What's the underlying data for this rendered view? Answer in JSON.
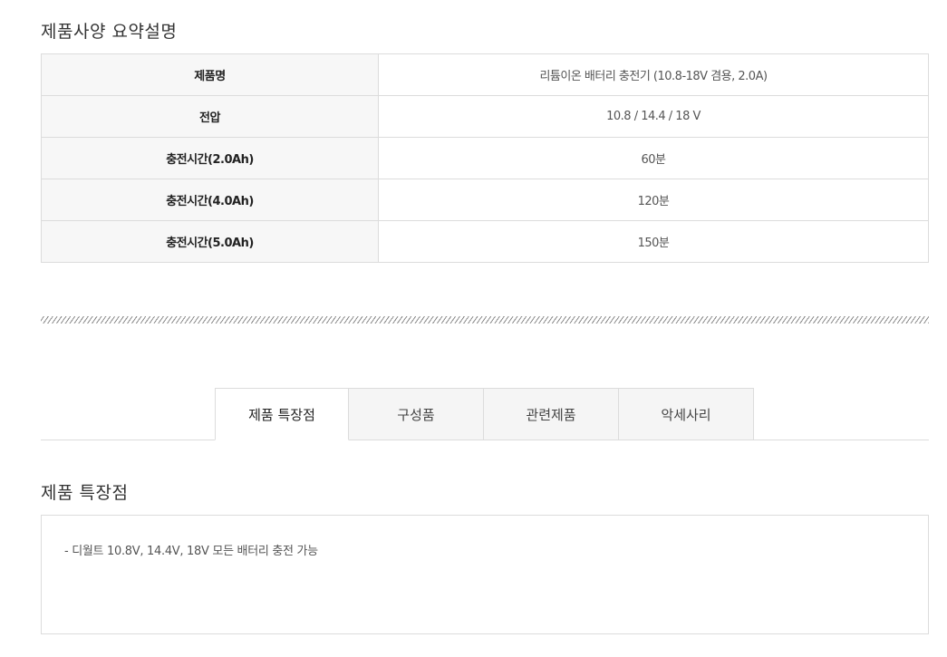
{
  "spec_section": {
    "title": "제품사양 요약설명",
    "rows": [
      {
        "label": "제품명",
        "value": "리튬이온 배터리 충전기 (10.8-18V 겸용, 2.0A)"
      },
      {
        "label": "전압",
        "value": "10.8 / 14.4 / 18 V"
      },
      {
        "label": "충전시간(2.0Ah)",
        "value": "60분"
      },
      {
        "label": "충전시간(4.0Ah)",
        "value": "120분"
      },
      {
        "label": "충전시간(5.0Ah)",
        "value": "150분"
      }
    ]
  },
  "tabs": [
    {
      "label": "제품 특장점",
      "active": true
    },
    {
      "label": "구성품",
      "active": false
    },
    {
      "label": "관련제품",
      "active": false
    },
    {
      "label": "악세사리",
      "active": false
    }
  ],
  "features_section": {
    "title": "제품 특장점",
    "lines": [
      "- 디월트 10.8V, 14.4V, 18V 모든 배터리 충전 가능"
    ]
  }
}
